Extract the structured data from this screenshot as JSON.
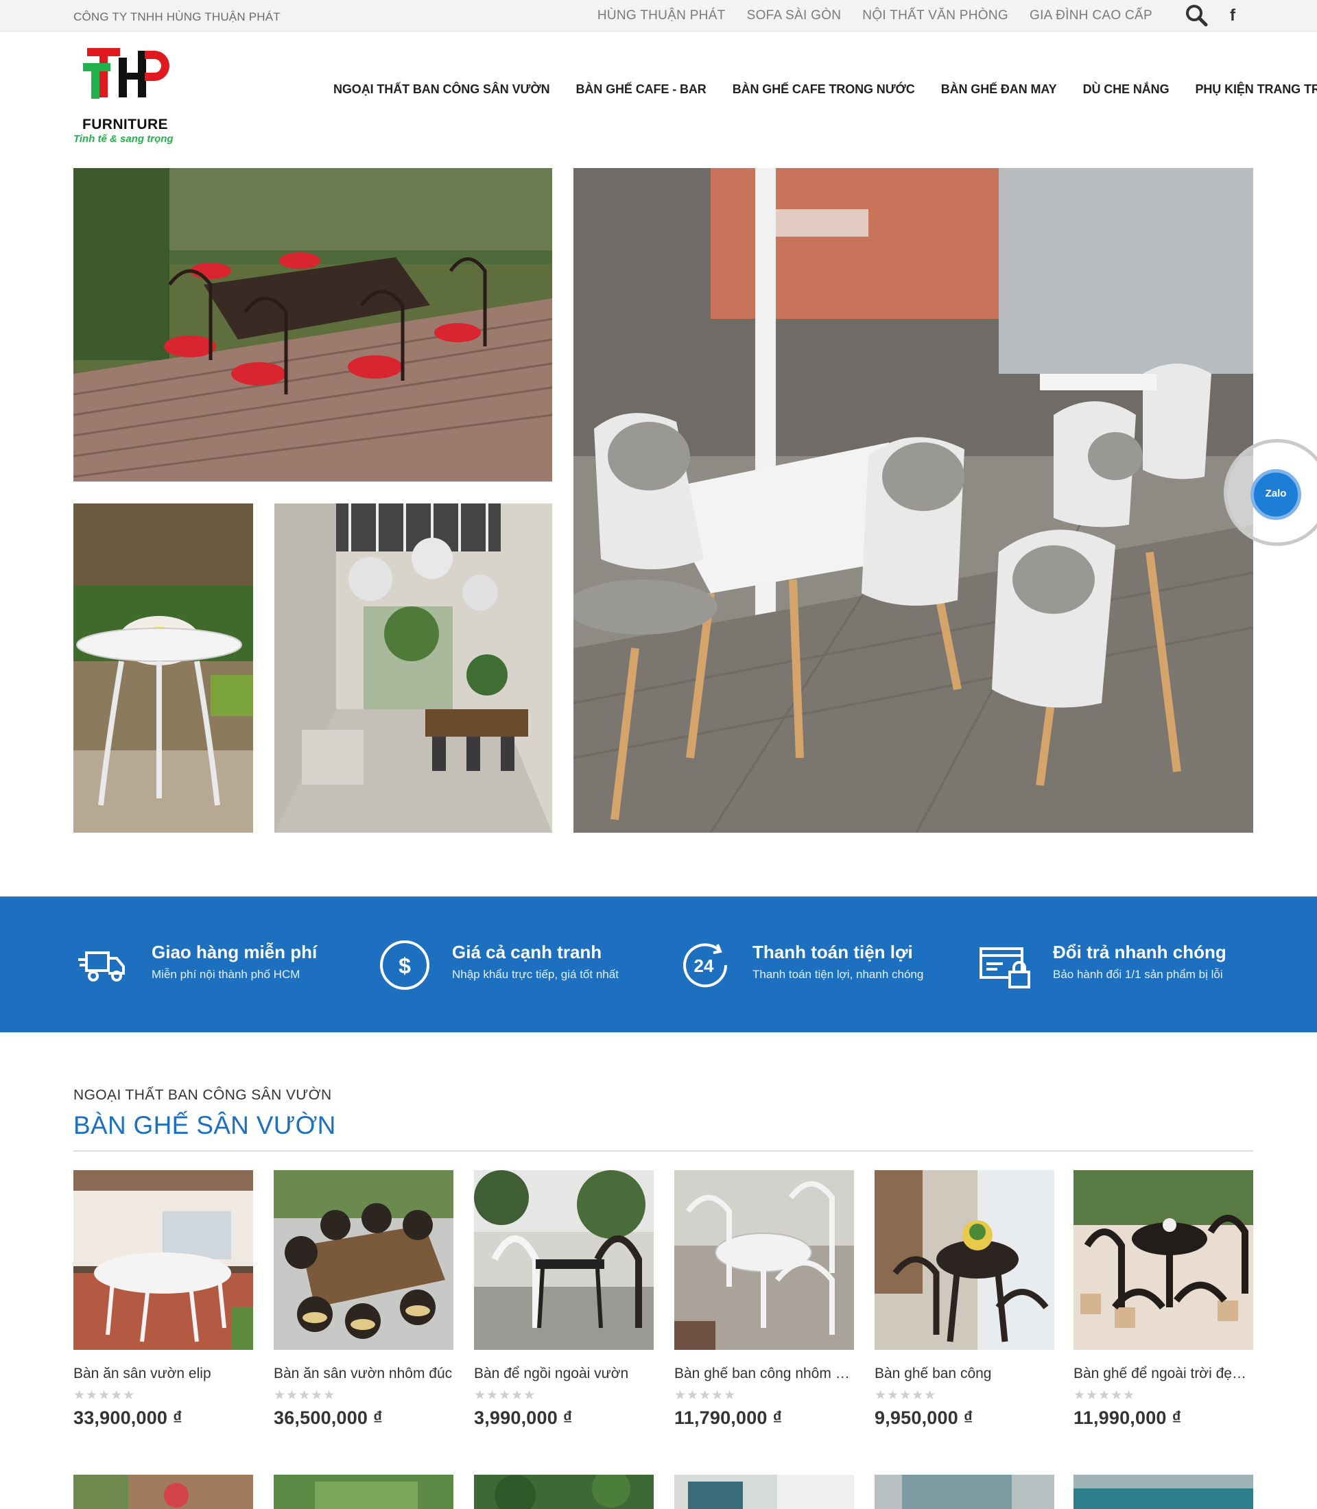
{
  "topbar": {
    "company": "CÔNG TY TNHH HÙNG THUẬN PHÁT",
    "links": [
      "HÙNG THUẬN PHÁT",
      "SOFA SÀI GÒN",
      "NỘI THẤT VĂN PHÒNG",
      "GIA ĐÌNH CAO CẤP"
    ],
    "icons": [
      "search-icon",
      "facebook-icon"
    ]
  },
  "header": {
    "logo_word": "FURNITURE",
    "logo_slogan": "Tinh tế & sang trọng",
    "nav": [
      "NGOẠI THẤT BAN CÔNG SÂN VƯỜN",
      "BÀN GHẾ CAFE - BAR",
      "BÀN GHẾ CAFE TRONG NƯỚC",
      "BÀN GHẾ ĐAN MAY",
      "DÙ CHE NẮNG",
      "PHỤ KIỆN TRANG TRÍ"
    ]
  },
  "zalo": {
    "label": "Zalo"
  },
  "features": [
    {
      "icon": "truck-icon",
      "title": "Giao hàng miễn phí",
      "subtitle": "Miễn phí nội thành phố HCM"
    },
    {
      "icon": "dollar-icon",
      "title": "Giá cả cạnh tranh",
      "subtitle": "Nhập khẩu trực tiếp, giá tốt nhất"
    },
    {
      "icon": "24h-icon",
      "title": "Thanh toán tiện lợi",
      "subtitle": "Thanh toán tiện lợi, nhanh chóng"
    },
    {
      "icon": "return-card-icon",
      "title": "Đổi trả nhanh chóng",
      "subtitle": "Bảo hành đổi 1/1 sản phẩm bị lỗi"
    }
  ],
  "section": {
    "kicker": "NGOẠI THẤT BAN CÔNG SÂN VƯỜN",
    "title": "BÀN GHẾ SÂN VƯỜN"
  },
  "products": [
    {
      "name": "Bàn ăn sân vườn elip",
      "price": "33,900,000 ₫",
      "rating": "★★★★★"
    },
    {
      "name": "Bàn ăn sân vườn nhôm đúc",
      "price": "36,500,000 ₫",
      "rating": "★★★★★"
    },
    {
      "name": "Bàn để ngồi ngoài vườn",
      "price": "3,990,000 ₫",
      "rating": "★★★★★"
    },
    {
      "name": "Bàn ghế ban công nhôm đú...",
      "price": "11,790,000 ₫",
      "rating": "★★★★★"
    },
    {
      "name": "Bàn ghế ban công",
      "price": "9,950,000 ₫",
      "rating": "★★★★★"
    },
    {
      "name": "Bàn ghế để ngoài trời đẹp t...",
      "price": "11,990,000 ₫",
      "rating": "★★★★★"
    }
  ]
}
